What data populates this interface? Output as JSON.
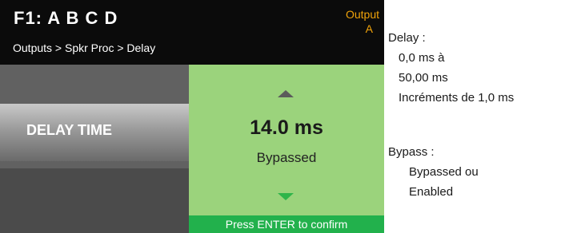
{
  "header": {
    "preset": "F1: A B C D",
    "breadcrumb": "Outputs > Spkr Proc > Delay",
    "output_label": "Output",
    "output_value": "A"
  },
  "parameter": {
    "label": "DELAY TIME",
    "value": "14.0 ms",
    "status": "Bypassed"
  },
  "confirm_text": "Press ENTER to confirm",
  "notes": {
    "delay_title": "Delay :",
    "delay_min": "0,0 ms à",
    "delay_max": "50,00 ms",
    "delay_step": "Incréments de 1,0 ms",
    "bypass_title": "Bypass :",
    "bypass_opt1": "Bypassed ou",
    "bypass_opt2": "Enabled"
  },
  "colors": {
    "header_bg": "#0b0b0b",
    "accent_orange": "#f0a30a",
    "value_panel": "#9bd37c",
    "confirm_bar": "#22b14c",
    "down_arrow": "#2fb54a"
  }
}
